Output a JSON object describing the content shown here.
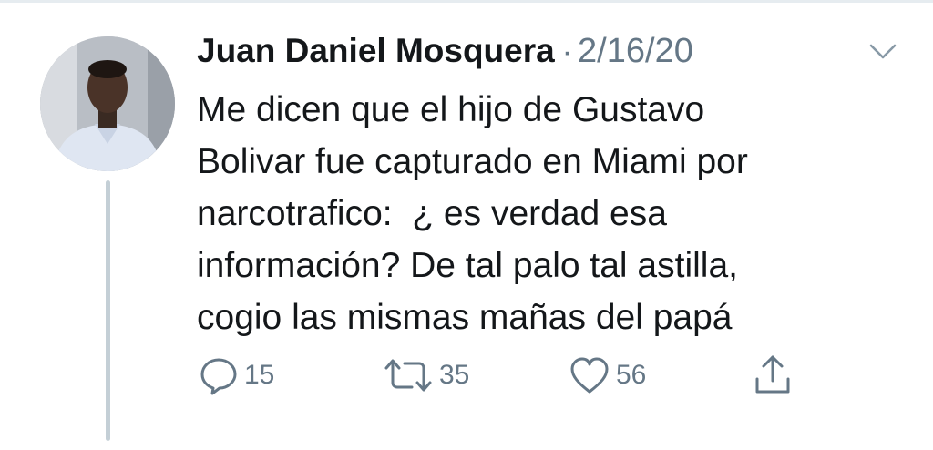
{
  "tweet": {
    "author_name": "Juan Daniel Mosquera",
    "separator": "·",
    "date": "2/16/20",
    "text_lines": [
      "Me dicen que el hijo de Gustavo",
      "Bolivar fue capturado en Miami por",
      "narcotrafico:  ¿ es verdad esa",
      "información? De tal palo tal astilla,",
      "cogio las mismas mañas del papá"
    ]
  },
  "actions": {
    "reply": {
      "icon": "reply-icon",
      "count": "15"
    },
    "retweet": {
      "icon": "retweet-icon",
      "count": "35"
    },
    "like": {
      "icon": "heart-icon",
      "count": "56"
    },
    "share": {
      "icon": "share-icon"
    }
  },
  "menu": {
    "icon": "chevron-down-icon"
  },
  "colors": {
    "text": "#14171a",
    "secondary": "#657786",
    "thread_line": "#c4cfd6"
  }
}
